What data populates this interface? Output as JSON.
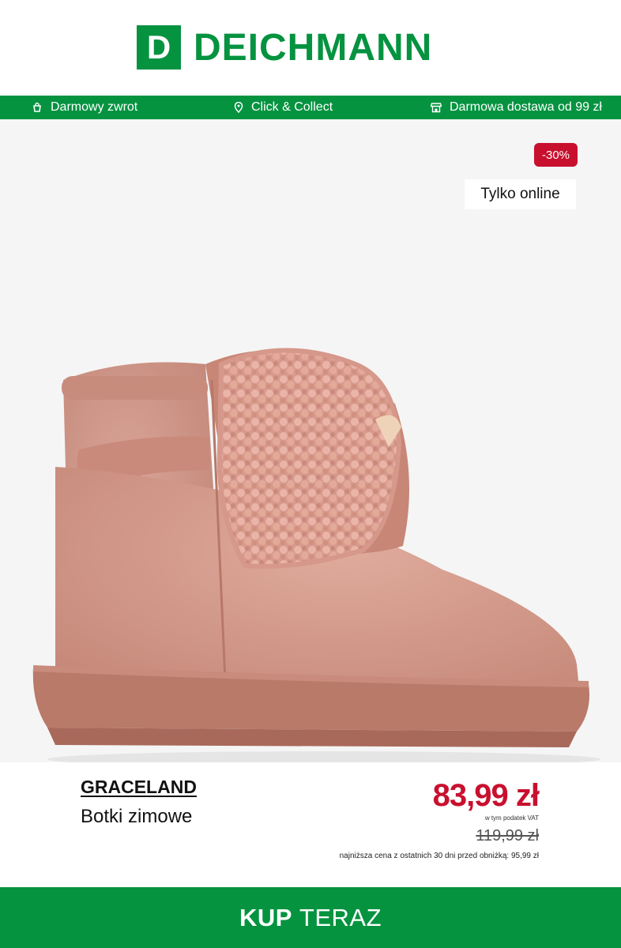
{
  "brand_logo": {
    "letter": "D",
    "name": "DEICHMANN",
    "color": "#059340"
  },
  "service_bar": [
    {
      "icon": "bag-return-icon",
      "label": "Darmowy zwrot"
    },
    {
      "icon": "location-pin-icon",
      "label": "Click & Collect"
    },
    {
      "icon": "store-icon",
      "label": "Darmowa dostawa od 99 zł"
    }
  ],
  "product": {
    "discount": "-30%",
    "online_badge": "Tylko online",
    "brand": "GRACELAND",
    "name": "Botki zimowe",
    "price": "83,99 zł",
    "vat_note": "w tym podatek VAT",
    "old_price": "119,99 zł",
    "lowest_price_note": "najniższa cena z ostatnich 30 dni przed obniżką: 95,99 zł"
  },
  "cta": {
    "bold": "KUP",
    "rest": "TERAZ"
  },
  "colors": {
    "green": "#059340",
    "red": "#c8102e",
    "image_bg": "#f5f5f5"
  }
}
